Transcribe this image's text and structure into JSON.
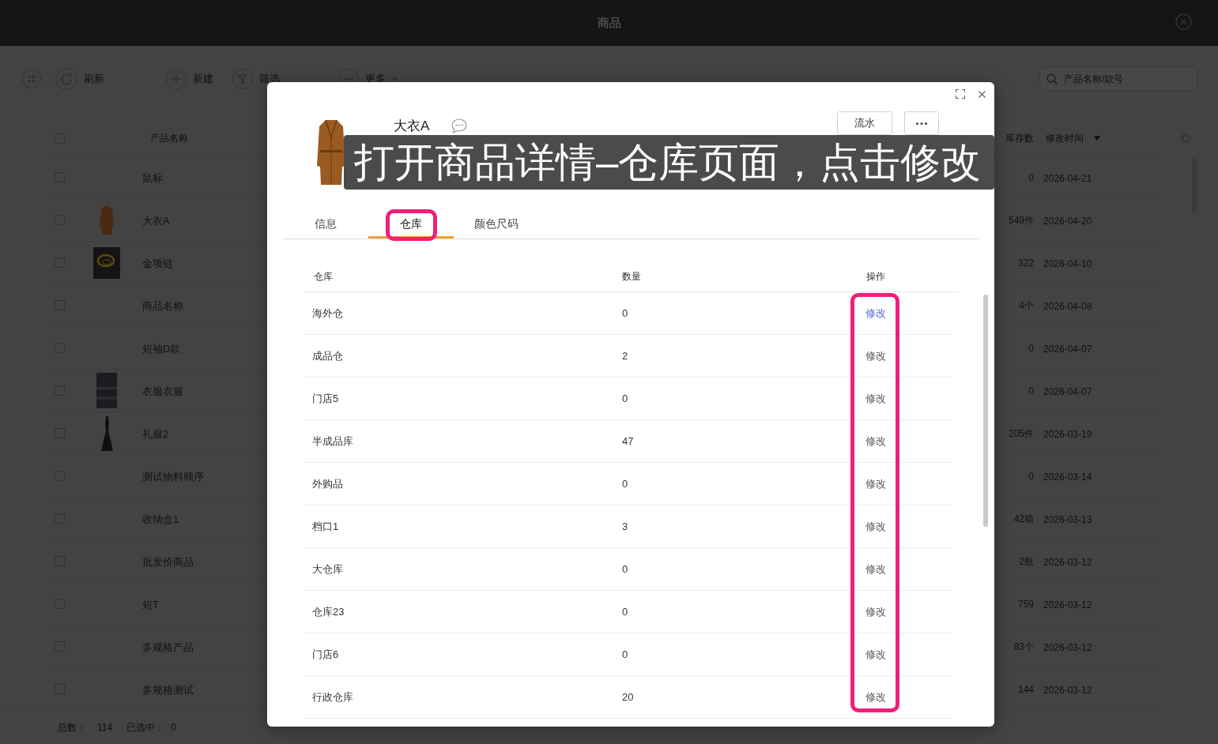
{
  "app": {
    "title": "商品"
  },
  "toolbar": {
    "buttons": [
      {
        "kind": "grid"
      },
      {
        "kind": "refresh",
        "label": "刷新"
      },
      {
        "kind": "add",
        "label": "新建"
      },
      {
        "kind": "filter",
        "label": "筛选"
      },
      {
        "kind": "more",
        "label": "更多"
      }
    ],
    "search": {
      "placeholder": "产品名称/款号"
    }
  },
  "product_table": {
    "select_all_checked": false,
    "columns": [
      {
        "label": "产品名称",
        "sorted": false
      },
      {
        "label": "库存数",
        "sorted": false
      },
      {
        "label": "修改时间",
        "sorted": true
      }
    ],
    "rows": [
      {
        "kind": "plain",
        "name": "鼠标",
        "stock": "0",
        "modified": "2026-04-21",
        "checked": false
      },
      {
        "kind": "coat",
        "name": "大衣A",
        "stock": "549件",
        "modified": "2026-04-20",
        "checked": false
      },
      {
        "kind": "necklace",
        "name": "金项链",
        "stock": "322",
        "modified": "2026-04-10",
        "checked": false
      },
      {
        "kind": "plain",
        "name": "商品名称",
        "stock": "4个",
        "modified": "2026-04-08",
        "checked": false
      },
      {
        "kind": "plain",
        "name": "短袖D款",
        "stock": "0",
        "modified": "2026-04-07",
        "checked": false
      },
      {
        "kind": "clothing",
        "name": "衣服衣服",
        "stock": "0",
        "modified": "2026-04-07",
        "checked": false
      },
      {
        "kind": "dress",
        "name": "礼服2",
        "stock": "205件",
        "modified": "2026-03-19",
        "checked": false
      },
      {
        "kind": "plain",
        "name": "测试物料顺序",
        "stock": "0",
        "modified": "2026-03-14",
        "checked": false
      },
      {
        "kind": "plain",
        "name": "收纳盒1",
        "stock": "42箱",
        "modified": "2026-03-13",
        "checked": false
      },
      {
        "kind": "plain",
        "name": "批发价商品",
        "stock": "2瓶",
        "modified": "2026-03-12",
        "checked": false
      },
      {
        "kind": "plain",
        "name": "短T",
        "stock": "759",
        "modified": "2026-03-12",
        "checked": false
      },
      {
        "kind": "plain",
        "name": "多规格产品",
        "stock": "83个",
        "modified": "2026-03-12",
        "checked": false
      },
      {
        "kind": "plain",
        "name": "多规格测试",
        "stock": "144",
        "modified": "2026-03-12",
        "checked": false
      }
    ]
  },
  "footer": {
    "total_label": "总数：",
    "total": "114",
    "selected_label": "已选中：",
    "selected": "0"
  },
  "dialog": {
    "product_name": "大衣A",
    "buttons": [
      {
        "kind": "text",
        "label": "流水"
      },
      {
        "kind": "more"
      }
    ],
    "tabs": [
      {
        "label": "信息",
        "selected": false,
        "highlighted": false
      },
      {
        "label": "仓库",
        "selected": true,
        "highlighted": true
      },
      {
        "label": "颜色尺码",
        "selected": false,
        "highlighted": false
      }
    ],
    "stock_table": {
      "columns": [
        "仓库",
        "数量",
        "操作"
      ],
      "highlight_actions": true,
      "rows": [
        {
          "warehouse": "海外仓",
          "quantity": "0",
          "action": "修改",
          "hovered": true
        },
        {
          "warehouse": "成品仓",
          "quantity": "2",
          "action": "修改",
          "hovered": false
        },
        {
          "warehouse": "门店5",
          "quantity": "0",
          "action": "修改",
          "hovered": false
        },
        {
          "warehouse": "半成品库",
          "quantity": "47",
          "action": "修改",
          "hovered": false
        },
        {
          "warehouse": "外购品",
          "quantity": "0",
          "action": "修改",
          "hovered": false
        },
        {
          "warehouse": "档口1",
          "quantity": "3",
          "action": "修改",
          "hovered": false
        },
        {
          "warehouse": "大仓库",
          "quantity": "0",
          "action": "修改",
          "hovered": false
        },
        {
          "warehouse": "仓库23",
          "quantity": "0",
          "action": "修改",
          "hovered": false
        },
        {
          "warehouse": "门店6",
          "quantity": "0",
          "action": "修改",
          "hovered": false
        },
        {
          "warehouse": "行政仓库",
          "quantity": "20",
          "action": "修改",
          "hovered": false
        }
      ]
    }
  },
  "caption": {
    "text": "打开商品详情–仓库页面，点击修改"
  }
}
